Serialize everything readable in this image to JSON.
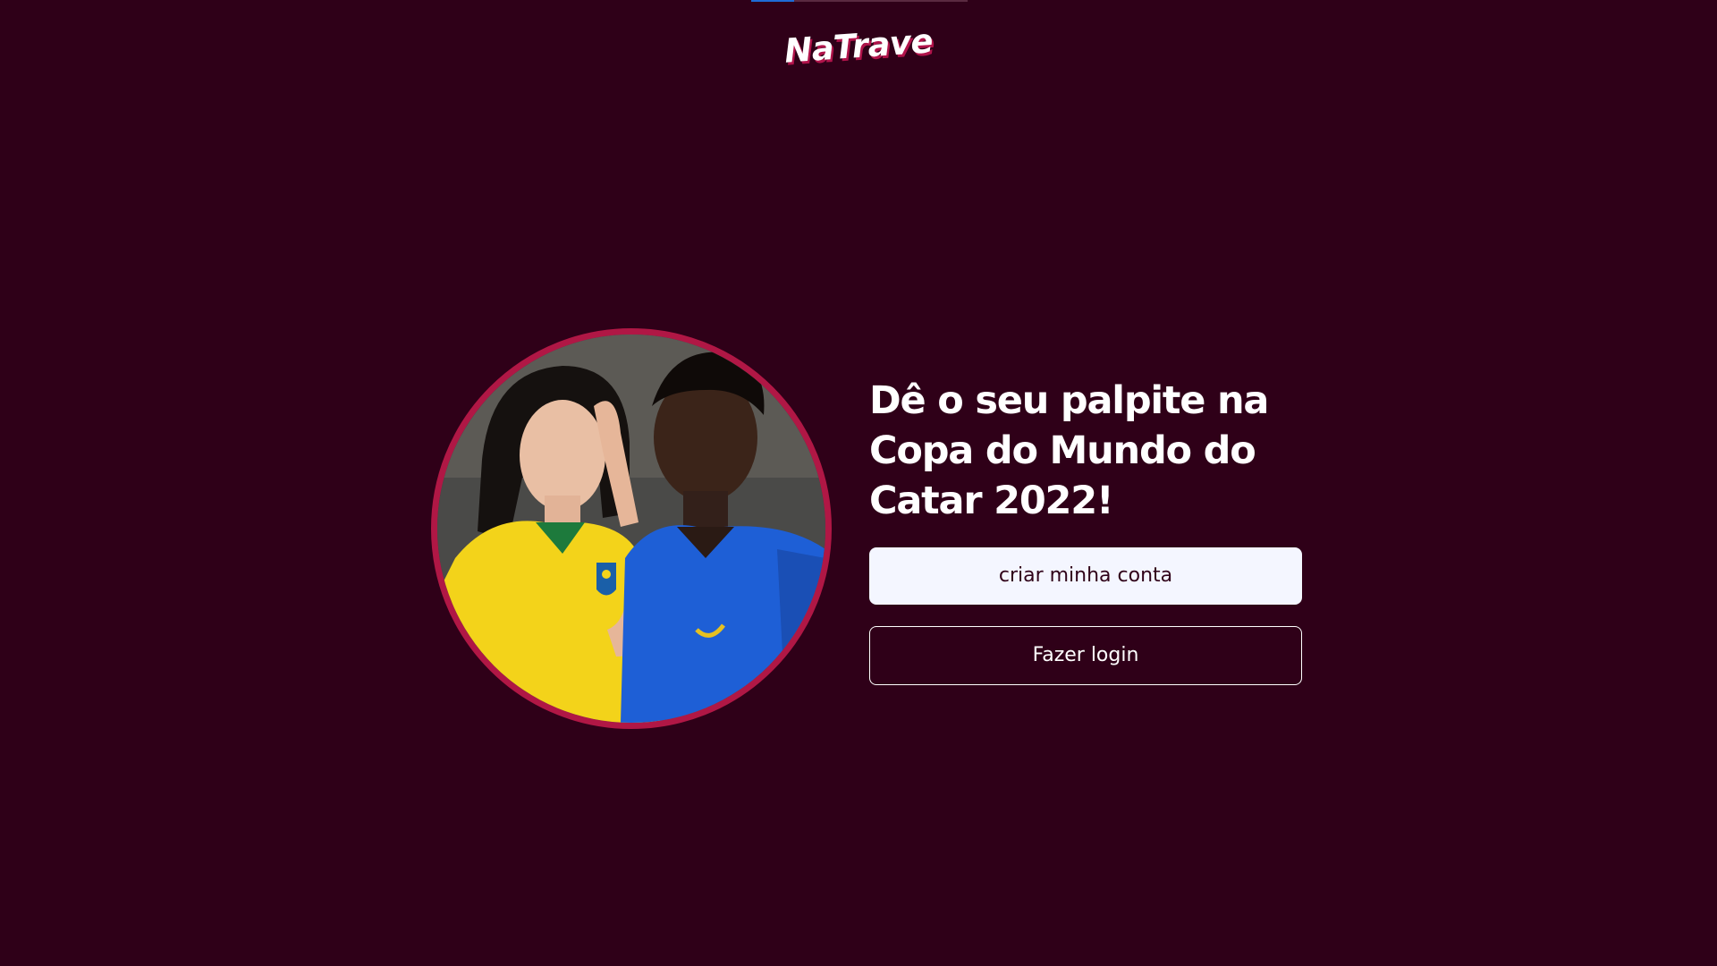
{
  "brand": {
    "logo_text": "NaTrave"
  },
  "hero": {
    "headline": "Dê o seu palpite na Copa do Mundo do Catar 2022!",
    "photo_alt": "Duas pessoas com camisas da seleção brasileira"
  },
  "actions": {
    "create_account_label": "criar minha conta",
    "login_label": "Fazer login"
  },
  "colors": {
    "background": "#2f0018",
    "accent": "#b01745",
    "primary_button_bg": "#f4f6ff",
    "primary_button_text": "#300219"
  }
}
